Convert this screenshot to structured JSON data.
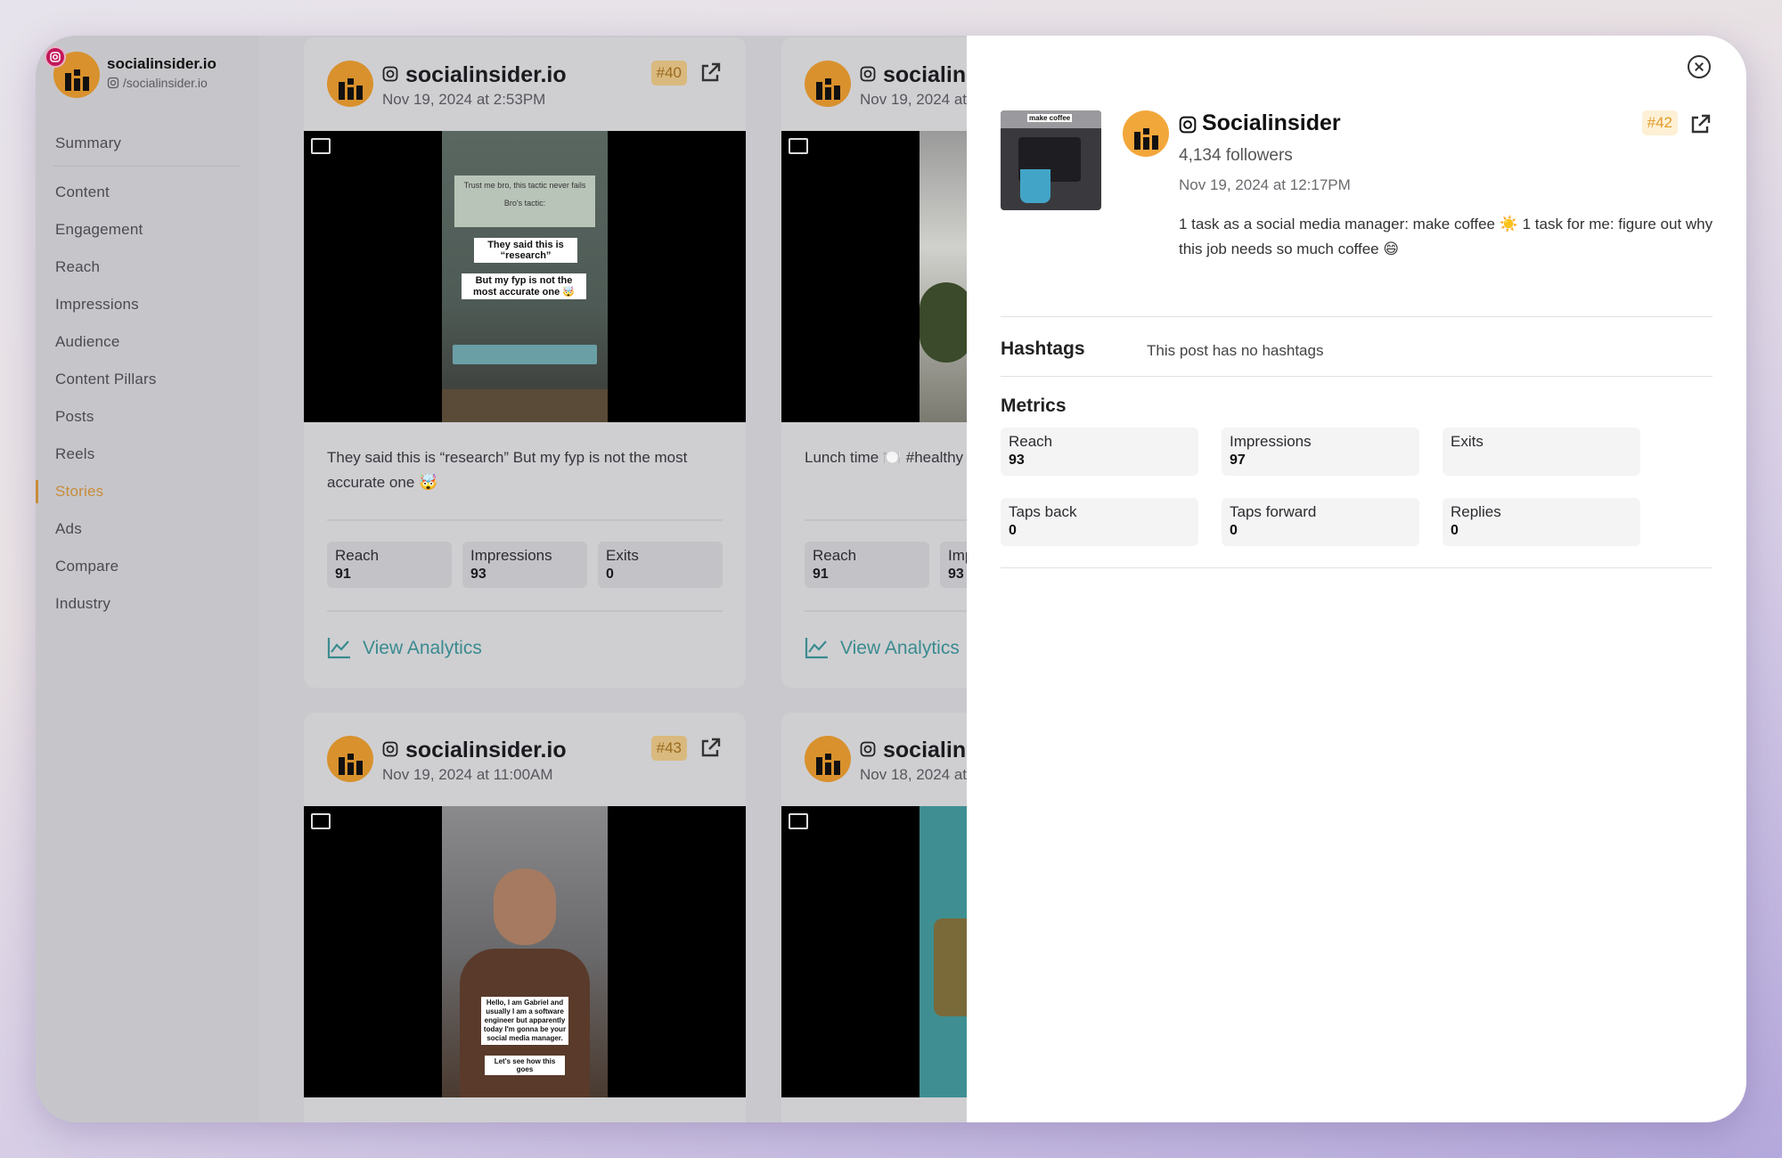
{
  "brand": {
    "name": "socialinsider.io",
    "handle": "/socialinsider.io"
  },
  "nav": [
    "Summary",
    "Content",
    "Engagement",
    "Reach",
    "Impressions",
    "Audience",
    "Content Pillars",
    "Posts",
    "Reels",
    "Stories",
    "Ads",
    "Compare",
    "Industry"
  ],
  "nav_active": "Stories",
  "cards": [
    {
      "name": "socialinsider.io",
      "date": "Nov 19, 2024 at 2:53PM",
      "badge": "#40",
      "caption": "They said this is “research” But my fyp is not the most accurate one 🤯",
      "metrics": [
        {
          "label": "Reach",
          "value": "91"
        },
        {
          "label": "Impressions",
          "value": "93"
        },
        {
          "label": "Exits",
          "value": "0"
        }
      ],
      "action": "View Analytics",
      "story_text": [
        "Trust me bro, this tactic never fails",
        "Bro's tactic:",
        "They said this is “research”",
        "But my fyp is not the most accurate one 🤯"
      ]
    },
    {
      "name": "socialinsider.io",
      "date": "Nov 19, 2024 at",
      "caption": "Lunch time 🍽️ #healthy",
      "metrics": [
        {
          "label": "Reach",
          "value": "91"
        },
        {
          "label": "Impressions",
          "value": "93"
        }
      ],
      "action": "View Analytics"
    },
    {
      "name": "socialinsider.io",
      "date": "Nov 19, 2024 at 11:00AM",
      "badge": "#43",
      "story_text": [
        "Hello, I am Gabriel and usually I am a software engineer but apparently today I'm gonna be your social media manager.",
        "Let's see how this goes"
      ]
    },
    {
      "name": "socialinsider.io",
      "date": "Nov 18, 2024 at"
    }
  ],
  "panel": {
    "name": "Socialinsider",
    "followers": "4,134 followers",
    "date": "Nov 19, 2024 at 12:17PM",
    "badge": "#42",
    "caption": "1 task as a social media manager: make coffee ☀️ 1 task for me: figure out why this job needs so much coffee 😄",
    "thumb_text": "make coffee",
    "hashtags_title": "Hashtags",
    "hashtags_text": "This post has no hashtags",
    "metrics_title": "Metrics",
    "metrics": [
      {
        "label": "Reach",
        "value": "93"
      },
      {
        "label": "Impressions",
        "value": "97"
      },
      {
        "label": "Exits",
        "value": ""
      },
      {
        "label": "Taps back",
        "value": "0"
      },
      {
        "label": "Taps forward",
        "value": "0"
      },
      {
        "label": "Replies",
        "value": "0"
      }
    ]
  },
  "colors": {
    "accent": "#c88c3a",
    "teal": "#3a8b8f",
    "avatar": "#f2a73b",
    "badge_bg": "#fdf0d5"
  }
}
